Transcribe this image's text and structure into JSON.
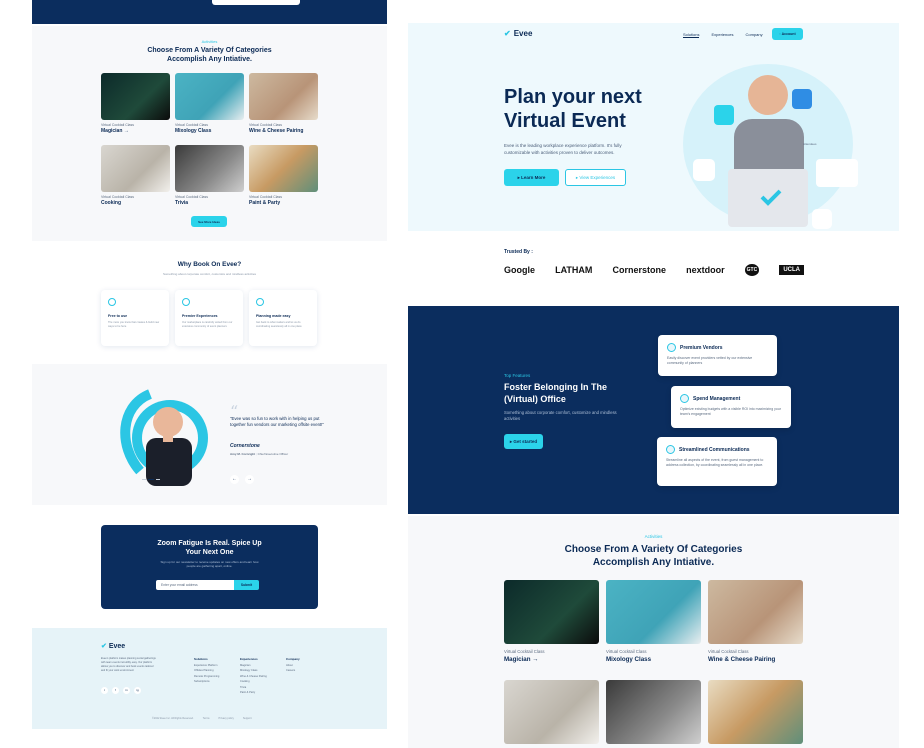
{
  "colors": {
    "navy": "#0b2d5e",
    "accent": "#2bd3ea",
    "light_bg": "#eef9fd"
  },
  "left": {
    "categories": {
      "label": "Activities",
      "title_line1": "Choose From A Variety Of Categories",
      "title_line2": "Accomplish Any Intiative.",
      "cards": [
        {
          "sub": "Virtual Cocktail Class",
          "title": "Magician →"
        },
        {
          "sub": "Virtual Cocktail Class",
          "title": "Mixology Class"
        },
        {
          "sub": "Virtual Cocktail Class",
          "title": "Wine & Cheese Pairing"
        },
        {
          "sub": "Virtual Cocktail Class",
          "title": "Cooking"
        },
        {
          "sub": "Virtual Cocktail Class",
          "title": "Trivia"
        },
        {
          "sub": "Virtual Cocktail Class",
          "title": "Paint & Party"
        }
      ],
      "button": "See More Ideas"
    },
    "why": {
      "title": "Why Book On Evee?",
      "subtitle": "Something about corporate comfort, customize and mindless activities",
      "cards": [
        {
          "title": "Free to use",
          "desc": "The more you know that creates & build new ways to be here"
        },
        {
          "title": "Premier Experiences",
          "desc": "Our marketplace is carefully vetted from our extensive community of event planners"
        },
        {
          "title": "Planning made easy",
          "desc": "Get back to what matters and let us do coordinating seamlessly all in one place"
        }
      ]
    },
    "testimonial": {
      "quote": "\"Evee was so fun to work with in helping us put together fun vendors our marketing offsite event!\"",
      "company": "Cornerstone",
      "person": "Amy M. Cornright",
      "role": "Chief Executive Officer",
      "prev": "←",
      "next": "→"
    },
    "zoom": {
      "title_line1": "Zoom Fatigue Is Real. Spice Up",
      "title_line2": "Your Next One",
      "subtitle": "Sign up for our newsletter to receive updates on new offers and learn how people are gathering apart, online.",
      "placeholder": "Enter your email address",
      "submit": "Submit"
    },
    "footer": {
      "brand": "Evee",
      "desc": "Evee's platform makes planning social gatherings with team events incredibly easy. Our platform allows you to discover and book events tailored and fit your work environment",
      "cols": [
        {
          "head": "Solutions",
          "items": [
            "Experience Platform",
            "Offsites Planning",
            "Remote Programming",
            "Subscriptions"
          ]
        },
        {
          "head": "Experiences",
          "items": [
            "Magician",
            "Mixology Class",
            "Wine & Cheese Pairing",
            "Cooking",
            "Trivia",
            "Paint & Party"
          ]
        },
        {
          "head": "Company",
          "items": [
            "About",
            "Careers"
          ]
        }
      ],
      "social": [
        "t",
        "f",
        "in",
        "ig"
      ],
      "copyright": "©2022 Evee Inc. All Rights Reserved.",
      "terms": "Terms",
      "privacy": "Privacy policy",
      "support": "Support"
    }
  },
  "right": {
    "nav": {
      "brand": "Evee",
      "links": [
        "Solutions",
        "Experiences",
        "Company"
      ],
      "account": "Account"
    },
    "hero": {
      "title_line1": "Plan your next",
      "title_line2": "Virtual Event",
      "subtitle": "Evee is the leading workplace experience platform. It's fully customizable with activities proven to deliver outcomes.",
      "primary": "Learn More",
      "secondary": "View Experiences",
      "attendees": "Attendees"
    },
    "trusted": {
      "label": "Trusted By :",
      "logos": [
        "Google",
        "LATHAM",
        "Cornerstone",
        "nextdoor",
        "GTC",
        "UCLA"
      ]
    },
    "features": {
      "label": "Top Features",
      "title": "Foster Belonging In The (Virtual) Office",
      "desc": "Something about corporate comfort, customize and mindless activities",
      "button": "Get started",
      "cards": [
        {
          "title": "Premium Vendors",
          "desc": "Easily discover event providers vetted by our extensive community of planners"
        },
        {
          "title": "Spend Management",
          "desc": "Optimize existing budgets with a visible ROI into maximizing your team's engagement"
        },
        {
          "title": "Streamlined Communications",
          "desc": "Streamline all aspects of the event, from guest management to address collection, by coordinating seamlessly all in one place."
        }
      ]
    },
    "categories": {
      "label": "Activities",
      "title_line1": "Choose From A Variety Of Categories",
      "title_line2": "Accomplish Any Intiative.",
      "cards": [
        {
          "sub": "Virtual Cocktail Class",
          "title": "Magician →"
        },
        {
          "sub": "Virtual Cocktail Class",
          "title": "Mixology Class"
        },
        {
          "sub": "Virtual Cocktail Class",
          "title": "Wine & Cheese Pairing"
        }
      ]
    }
  }
}
